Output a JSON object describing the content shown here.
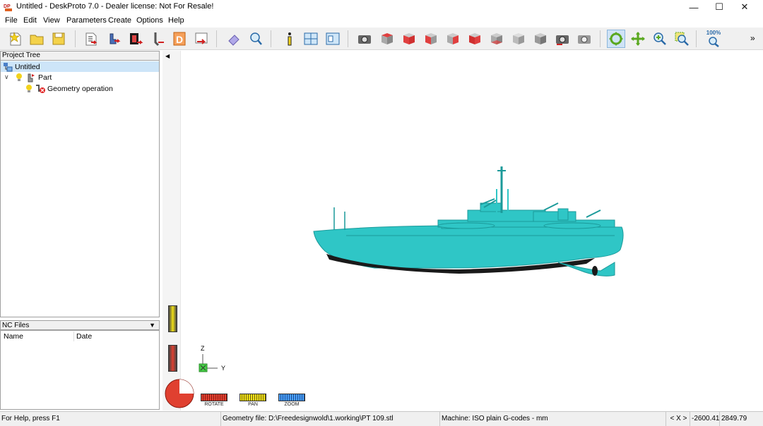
{
  "window": {
    "title": "Untitled - DeskProto 7.0 - Dealer license: Not For Resale!",
    "minimize": "—",
    "maximize": "☐",
    "close": "✕"
  },
  "menu": [
    "File",
    "Edit",
    "View",
    "Parameters",
    "Create",
    "Options",
    "Help"
  ],
  "toolbar": {
    "zoom_percent": "100%",
    "overflow": "»"
  },
  "project_tree": {
    "title": "Project Tree",
    "root": "Untitled",
    "part": "Part",
    "operation": "Geometry operation"
  },
  "nc_files": {
    "title": "NC Files",
    "columns": [
      "Name",
      "Date"
    ]
  },
  "view_controls": {
    "rotate": "ROTATE",
    "pan": "PAN",
    "zoom": "ZOOM",
    "axis_z": "Z",
    "axis_y": "Y"
  },
  "status": {
    "help": "For Help, press F1",
    "geometry": "Geometry file: D:\\Freedesignwold\\1.working\\PT 109.stl",
    "machine": "Machine: ISO plain G-codes - mm",
    "axes": "< X >",
    "coord_x": "-2600.41",
    "coord_y": "2849.79"
  },
  "colors": {
    "model": "#2fc6c6",
    "hull_shadow": "#1a1a1a",
    "selection": "#cde5f8"
  }
}
